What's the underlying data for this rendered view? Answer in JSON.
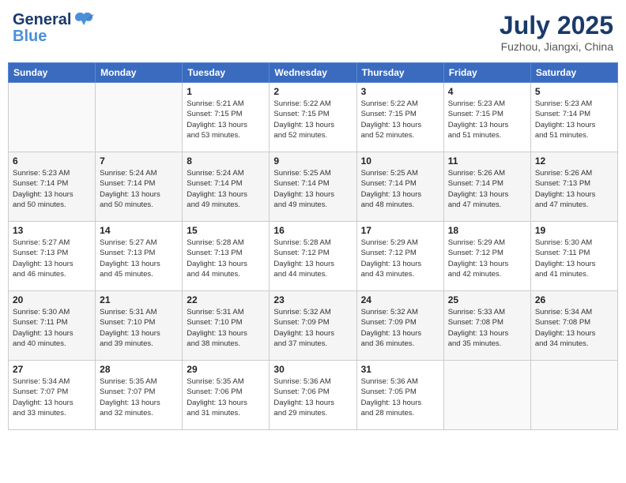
{
  "header": {
    "logo_line1": "General",
    "logo_line2": "Blue",
    "month_year": "July 2025",
    "location": "Fuzhou, Jiangxi, China"
  },
  "weekdays": [
    "Sunday",
    "Monday",
    "Tuesday",
    "Wednesday",
    "Thursday",
    "Friday",
    "Saturday"
  ],
  "weeks": [
    [
      {
        "day": "",
        "info": ""
      },
      {
        "day": "",
        "info": ""
      },
      {
        "day": "1",
        "info": "Sunrise: 5:21 AM\nSunset: 7:15 PM\nDaylight: 13 hours\nand 53 minutes."
      },
      {
        "day": "2",
        "info": "Sunrise: 5:22 AM\nSunset: 7:15 PM\nDaylight: 13 hours\nand 52 minutes."
      },
      {
        "day": "3",
        "info": "Sunrise: 5:22 AM\nSunset: 7:15 PM\nDaylight: 13 hours\nand 52 minutes."
      },
      {
        "day": "4",
        "info": "Sunrise: 5:23 AM\nSunset: 7:15 PM\nDaylight: 13 hours\nand 51 minutes."
      },
      {
        "day": "5",
        "info": "Sunrise: 5:23 AM\nSunset: 7:14 PM\nDaylight: 13 hours\nand 51 minutes."
      }
    ],
    [
      {
        "day": "6",
        "info": "Sunrise: 5:23 AM\nSunset: 7:14 PM\nDaylight: 13 hours\nand 50 minutes."
      },
      {
        "day": "7",
        "info": "Sunrise: 5:24 AM\nSunset: 7:14 PM\nDaylight: 13 hours\nand 50 minutes."
      },
      {
        "day": "8",
        "info": "Sunrise: 5:24 AM\nSunset: 7:14 PM\nDaylight: 13 hours\nand 49 minutes."
      },
      {
        "day": "9",
        "info": "Sunrise: 5:25 AM\nSunset: 7:14 PM\nDaylight: 13 hours\nand 49 minutes."
      },
      {
        "day": "10",
        "info": "Sunrise: 5:25 AM\nSunset: 7:14 PM\nDaylight: 13 hours\nand 48 minutes."
      },
      {
        "day": "11",
        "info": "Sunrise: 5:26 AM\nSunset: 7:14 PM\nDaylight: 13 hours\nand 47 minutes."
      },
      {
        "day": "12",
        "info": "Sunrise: 5:26 AM\nSunset: 7:13 PM\nDaylight: 13 hours\nand 47 minutes."
      }
    ],
    [
      {
        "day": "13",
        "info": "Sunrise: 5:27 AM\nSunset: 7:13 PM\nDaylight: 13 hours\nand 46 minutes."
      },
      {
        "day": "14",
        "info": "Sunrise: 5:27 AM\nSunset: 7:13 PM\nDaylight: 13 hours\nand 45 minutes."
      },
      {
        "day": "15",
        "info": "Sunrise: 5:28 AM\nSunset: 7:13 PM\nDaylight: 13 hours\nand 44 minutes."
      },
      {
        "day": "16",
        "info": "Sunrise: 5:28 AM\nSunset: 7:12 PM\nDaylight: 13 hours\nand 44 minutes."
      },
      {
        "day": "17",
        "info": "Sunrise: 5:29 AM\nSunset: 7:12 PM\nDaylight: 13 hours\nand 43 minutes."
      },
      {
        "day": "18",
        "info": "Sunrise: 5:29 AM\nSunset: 7:12 PM\nDaylight: 13 hours\nand 42 minutes."
      },
      {
        "day": "19",
        "info": "Sunrise: 5:30 AM\nSunset: 7:11 PM\nDaylight: 13 hours\nand 41 minutes."
      }
    ],
    [
      {
        "day": "20",
        "info": "Sunrise: 5:30 AM\nSunset: 7:11 PM\nDaylight: 13 hours\nand 40 minutes."
      },
      {
        "day": "21",
        "info": "Sunrise: 5:31 AM\nSunset: 7:10 PM\nDaylight: 13 hours\nand 39 minutes."
      },
      {
        "day": "22",
        "info": "Sunrise: 5:31 AM\nSunset: 7:10 PM\nDaylight: 13 hours\nand 38 minutes."
      },
      {
        "day": "23",
        "info": "Sunrise: 5:32 AM\nSunset: 7:09 PM\nDaylight: 13 hours\nand 37 minutes."
      },
      {
        "day": "24",
        "info": "Sunrise: 5:32 AM\nSunset: 7:09 PM\nDaylight: 13 hours\nand 36 minutes."
      },
      {
        "day": "25",
        "info": "Sunrise: 5:33 AM\nSunset: 7:08 PM\nDaylight: 13 hours\nand 35 minutes."
      },
      {
        "day": "26",
        "info": "Sunrise: 5:34 AM\nSunset: 7:08 PM\nDaylight: 13 hours\nand 34 minutes."
      }
    ],
    [
      {
        "day": "27",
        "info": "Sunrise: 5:34 AM\nSunset: 7:07 PM\nDaylight: 13 hours\nand 33 minutes."
      },
      {
        "day": "28",
        "info": "Sunrise: 5:35 AM\nSunset: 7:07 PM\nDaylight: 13 hours\nand 32 minutes."
      },
      {
        "day": "29",
        "info": "Sunrise: 5:35 AM\nSunset: 7:06 PM\nDaylight: 13 hours\nand 31 minutes."
      },
      {
        "day": "30",
        "info": "Sunrise: 5:36 AM\nSunset: 7:06 PM\nDaylight: 13 hours\nand 29 minutes."
      },
      {
        "day": "31",
        "info": "Sunrise: 5:36 AM\nSunset: 7:05 PM\nDaylight: 13 hours\nand 28 minutes."
      },
      {
        "day": "",
        "info": ""
      },
      {
        "day": "",
        "info": ""
      }
    ]
  ]
}
